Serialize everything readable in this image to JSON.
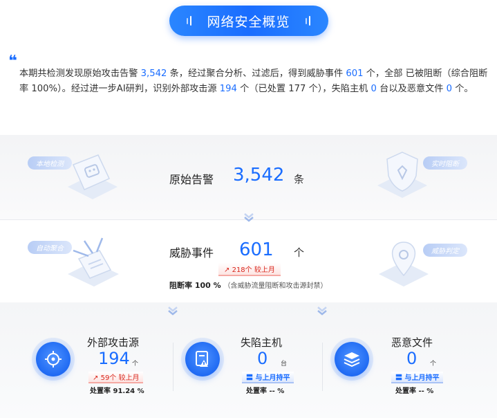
{
  "header": {
    "title": "网络安全概览"
  },
  "summary": {
    "part1": "本期共检测发现原始攻击告警 ",
    "alerts": "3,542",
    "part2": " 条，经过聚合分析、过滤后，得到威胁事件 ",
    "events": "601",
    "part3": " 个，全部 已被阻断（综合阻断率 100%）。经过进一步AI研判，识别外部攻击源 ",
    "sources": "194",
    "part4": " 个（已处置 177 个），失陷主机 ",
    "hosts": "0",
    "part5": " 台以及恶意文件 ",
    "files": "0",
    "part6": " 个。"
  },
  "tags": {
    "local_detect": "本地检测",
    "realtime_block": "实时阻断",
    "auto_aggregate": "自动聚合",
    "threat_judge": "威胁判定"
  },
  "alerts_row": {
    "label": "原始告警",
    "value": "3,542",
    "unit": "条"
  },
  "events_row": {
    "label": "威胁事件",
    "value": "601",
    "unit": "个",
    "trend": "218个 较上月",
    "block_rate_label": "阻断率 100 %",
    "block_rate_note": "（含威胁流量阻断和攻击源封禁）"
  },
  "stats": [
    {
      "title": "外部攻击源",
      "value": "194",
      "unit": "个",
      "trend": "59个 较上月",
      "rate": "处置率 91.24 %"
    },
    {
      "title": "失陷主机",
      "value": "0",
      "unit": "台",
      "trend": "与上月持平",
      "rate": "处置率 -- %"
    },
    {
      "title": "恶意文件",
      "value": "0",
      "unit": "个",
      "trend": "与上月持平",
      "rate": "处置率 -- %"
    }
  ],
  "colors": {
    "accent": "#1a6dff",
    "up": "#d9261c"
  },
  "icons": {
    "stat_0": "crosshair-target-icon",
    "stat_1": "infected-host-icon",
    "stat_2": "malicious-file-stack-icon"
  }
}
